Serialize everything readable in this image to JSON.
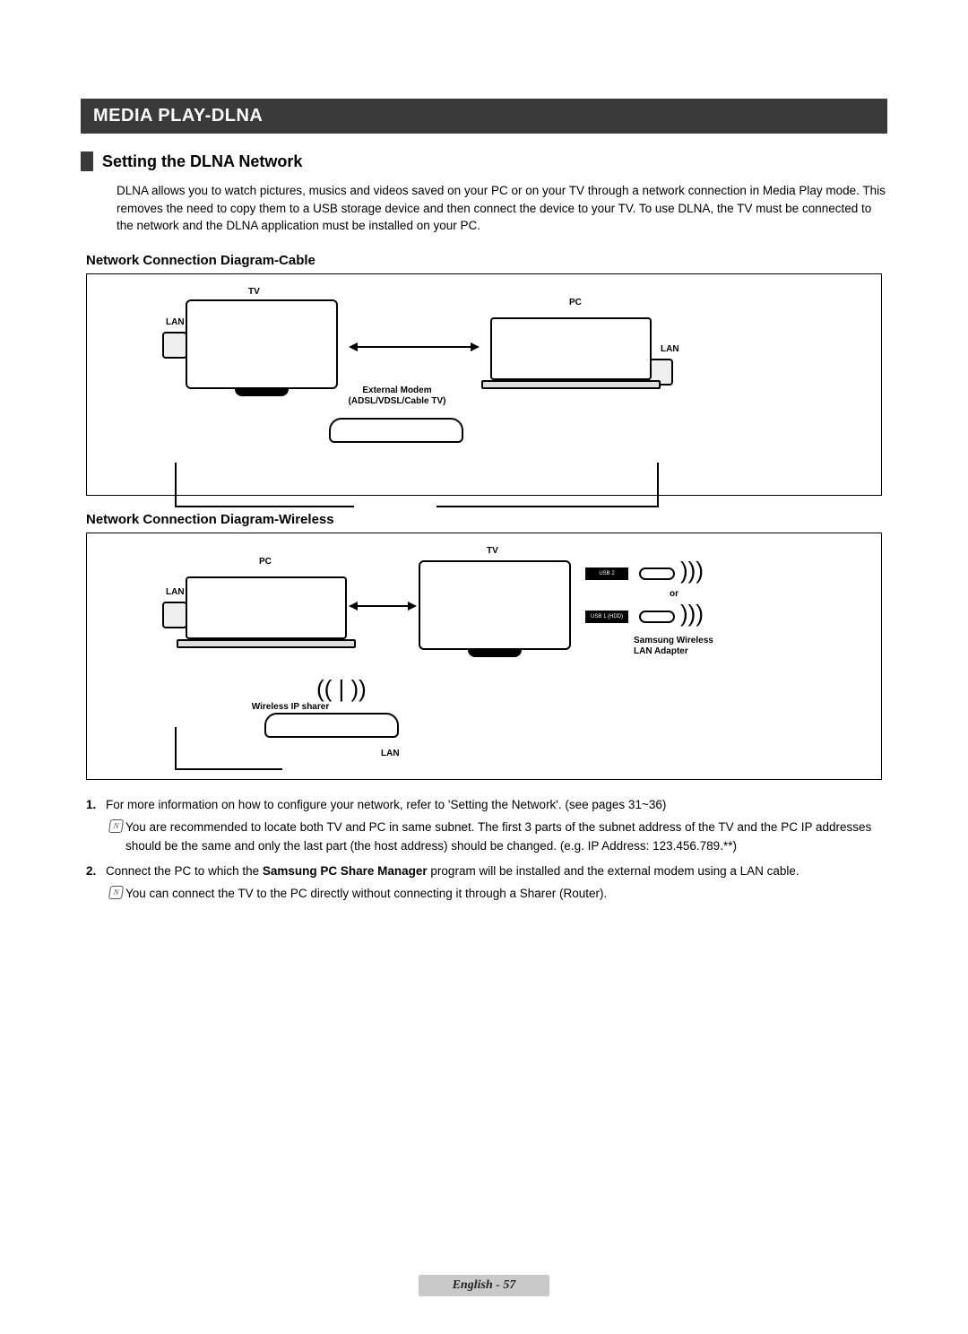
{
  "chapter": "MEDIA PLAY-DLNA",
  "section": {
    "title": "Setting the DLNA Network",
    "intro": "DLNA allows you to watch pictures, musics and videos saved on your PC or on your TV through a network connection in Media Play mode. This removes the need to copy them to a USB storage device and then connect the device to your TV. To use DLNA, the TV must be connected to the network and the DLNA application must be installed on your PC."
  },
  "diagram_cable": {
    "heading": "Network Connection Diagram-Cable",
    "labels": {
      "tv": "TV",
      "pc": "PC",
      "lan_left": "LAN",
      "lan_right": "LAN",
      "modem_l1": "External Modem",
      "modem_l2": "(ADSL/VDSL/Cable TV)"
    }
  },
  "diagram_wireless": {
    "heading": "Network Connection Diagram-Wireless",
    "labels": {
      "tv": "TV",
      "pc": "PC",
      "lan_left": "LAN",
      "lan_bottom": "LAN",
      "or": "or",
      "router": "Wireless IP sharer",
      "adapter_l1": "Samsung Wireless",
      "adapter_l2": "LAN Adapter",
      "port1": "USB 2",
      "port2": "USB 1 (HDD)"
    }
  },
  "steps": {
    "s1": {
      "num": "1.",
      "text": "For more information on how to configure your network, refer to 'Setting the Network'. (see pages 31~36)",
      "note": "You are recommended to locate both TV and PC in same subnet. The first 3 parts of the subnet address of the TV and the PC IP addresses should be the same and only the last part (the host address) should be changed. (e.g. IP Address: 123.456.789.**)"
    },
    "s2": {
      "num": "2.",
      "text_a": "Connect the PC to which the ",
      "text_bold": "Samsung PC Share Manager",
      "text_b": " program will be installed and the external modem using a LAN cable.",
      "note": "You can connect the TV to the PC directly without connecting it through a Sharer (Router)."
    }
  },
  "footer": {
    "lang": "English - ",
    "page": "57"
  }
}
